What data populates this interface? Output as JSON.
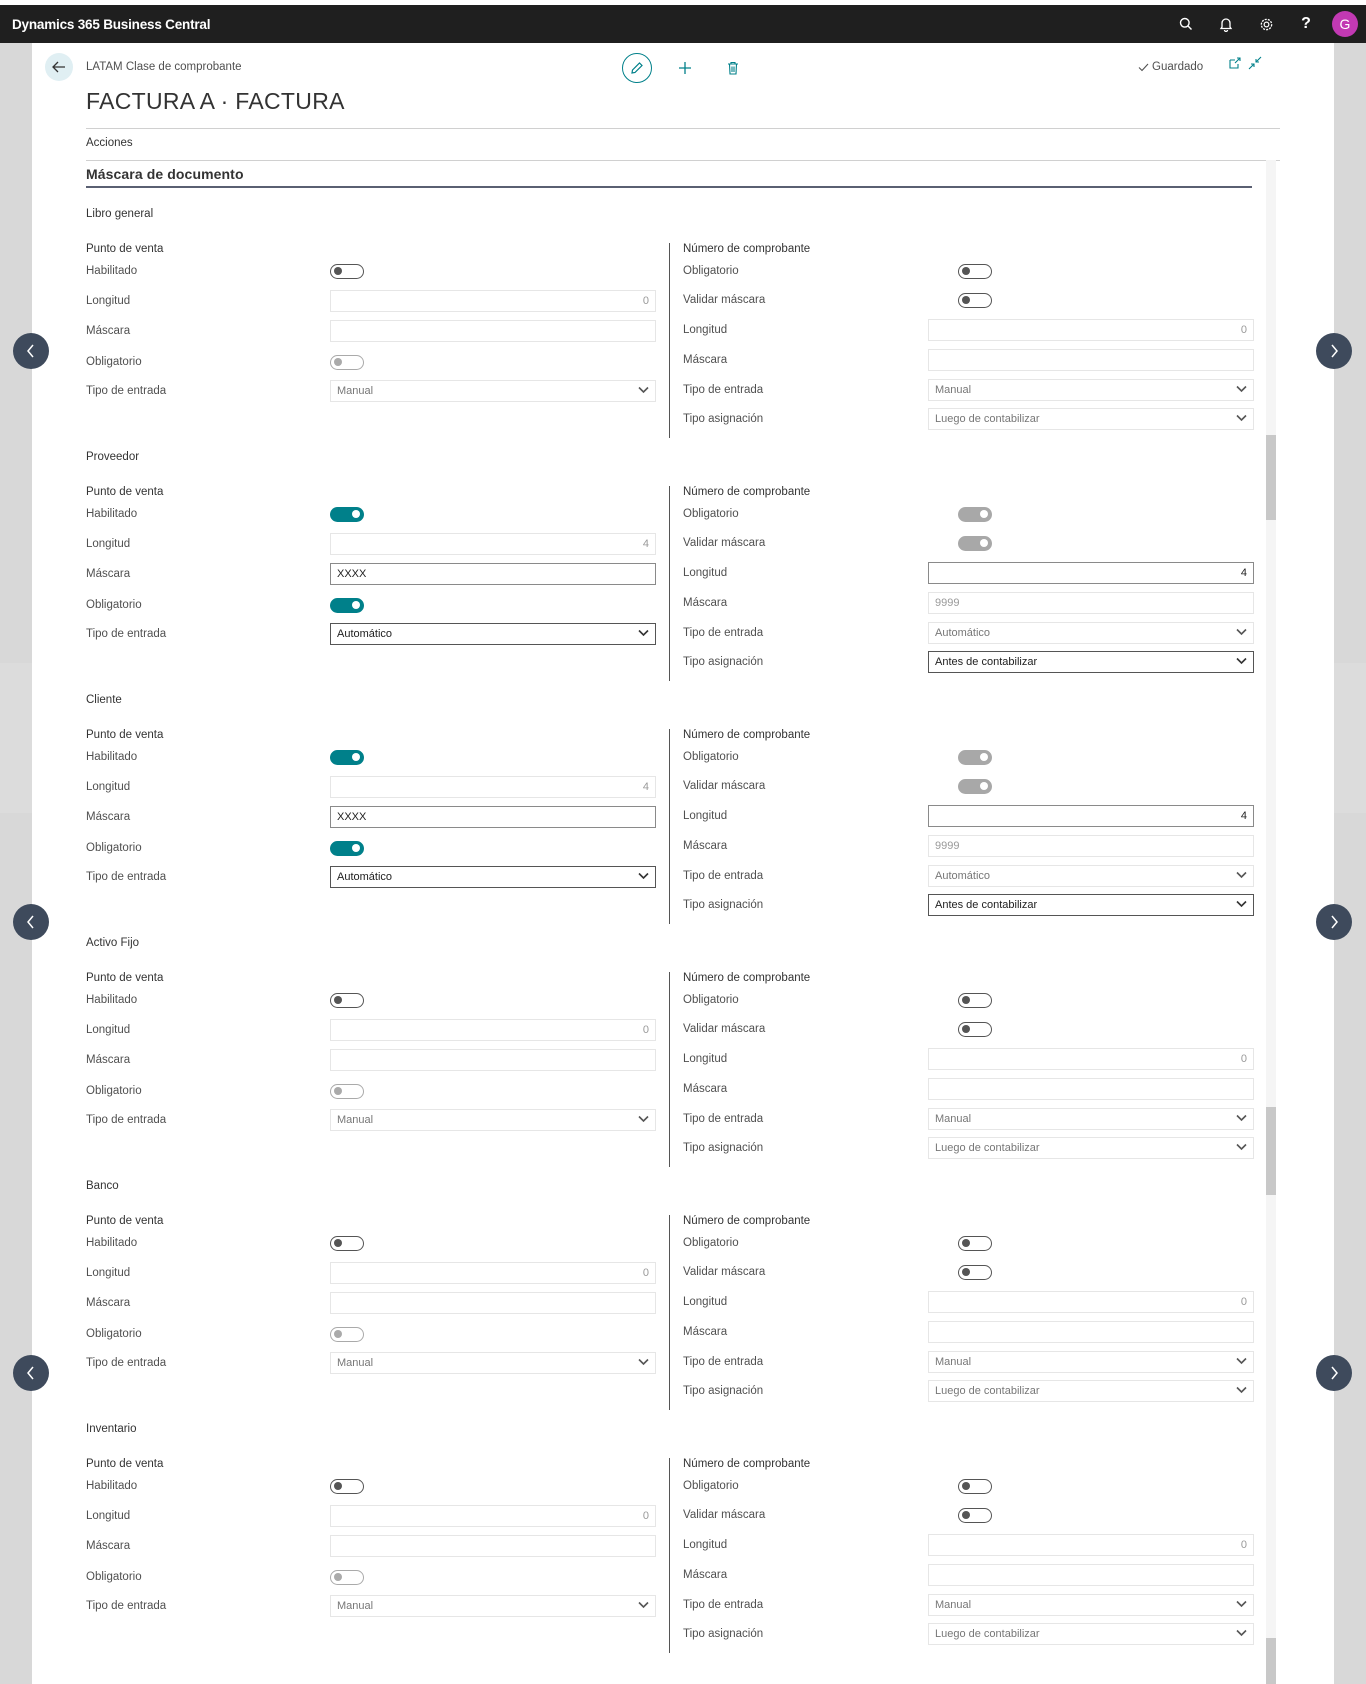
{
  "app": {
    "title": "Dynamics 365 Business Central",
    "avatar_letter": "G"
  },
  "header": {
    "breadcrumb": "LATAM Clase de comprobante",
    "title": "FACTURA A · FACTURA",
    "saved": "Guardado",
    "actions": "Acciones"
  },
  "section": {
    "title": "Máscara de documento"
  },
  "labels": {
    "punto_de_venta": "Punto de venta",
    "numero_comprobante": "Número de comprobante",
    "habilitado": "Habilitado",
    "longitud": "Longitud",
    "mascara": "Máscara",
    "obligatorio": "Obligatorio",
    "tipo_entrada": "Tipo de entrada",
    "validar_mascara": "Validar máscara",
    "tipo_asignacion": "Tipo asignación"
  },
  "groups": [
    {
      "title": "Libro general",
      "left": {
        "habilitado": "off",
        "longitud": "0",
        "mascara": "",
        "obligatorio": "disabled",
        "tipo_entrada": "Manual",
        "active": false
      },
      "right": {
        "obligatorio": "off",
        "validar_mascara": "off",
        "longitud": "0",
        "mascara": "",
        "tipo_entrada": "Manual",
        "tipo_asignacion": "Luego de contabilizar",
        "active": false
      }
    },
    {
      "title": "Proveedor",
      "left": {
        "habilitado": "on",
        "longitud": "4",
        "mascara": "XXXX",
        "obligatorio": "on",
        "tipo_entrada": "Automático",
        "active": true
      },
      "right": {
        "obligatorio": "disabled-on",
        "validar_mascara": "disabled-on",
        "longitud": "4",
        "mascara": "9999",
        "tipo_entrada": "Automático",
        "tipo_asignacion": "Antes de contabilizar",
        "active": true
      }
    },
    {
      "title": "Cliente",
      "left": {
        "habilitado": "on",
        "longitud": "4",
        "mascara": "XXXX",
        "obligatorio": "on",
        "tipo_entrada": "Automático",
        "active": true
      },
      "right": {
        "obligatorio": "disabled-on",
        "validar_mascara": "disabled-on",
        "longitud": "4",
        "mascara": "9999",
        "tipo_entrada": "Automático",
        "tipo_asignacion": "Antes de contabilizar",
        "active": true
      }
    },
    {
      "title": "Activo Fijo",
      "left": {
        "habilitado": "off",
        "longitud": "0",
        "mascara": "",
        "obligatorio": "disabled",
        "tipo_entrada": "Manual",
        "active": false
      },
      "right": {
        "obligatorio": "off",
        "validar_mascara": "off",
        "longitud": "0",
        "mascara": "",
        "tipo_entrada": "Manual",
        "tipo_asignacion": "Luego de contabilizar",
        "active": false
      }
    },
    {
      "title": "Banco",
      "left": {
        "habilitado": "off",
        "longitud": "0",
        "mascara": "",
        "obligatorio": "disabled",
        "tipo_entrada": "Manual",
        "active": false
      },
      "right": {
        "obligatorio": "off",
        "validar_mascara": "off",
        "longitud": "0",
        "mascara": "",
        "tipo_entrada": "Manual",
        "tipo_asignacion": "Luego de contabilizar",
        "active": false
      }
    },
    {
      "title": "Inventario",
      "left": {
        "habilitado": "off",
        "longitud": "0",
        "mascara": "",
        "obligatorio": "disabled",
        "tipo_entrada": "Manual",
        "active": false
      },
      "right": {
        "obligatorio": "off",
        "validar_mascara": "off",
        "longitud": "0",
        "mascara": "",
        "tipo_entrada": "Manual",
        "tipo_asignacion": "Luego de contabilizar",
        "active": false
      }
    }
  ],
  "icons": {
    "back": "arrow-left-icon",
    "edit": "pencil-icon",
    "new": "plus-icon",
    "delete": "trash-icon",
    "search": "search-icon",
    "bell": "bell-icon",
    "settings": "gear-icon",
    "help": "help-icon",
    "popout": "open-in-new-window-icon",
    "collapse": "collapse-icon",
    "saved": "checkmark-icon"
  },
  "colors": {
    "accent": "#00808a",
    "topbar": "#1f1f1f",
    "avatar": "#c239b3"
  }
}
